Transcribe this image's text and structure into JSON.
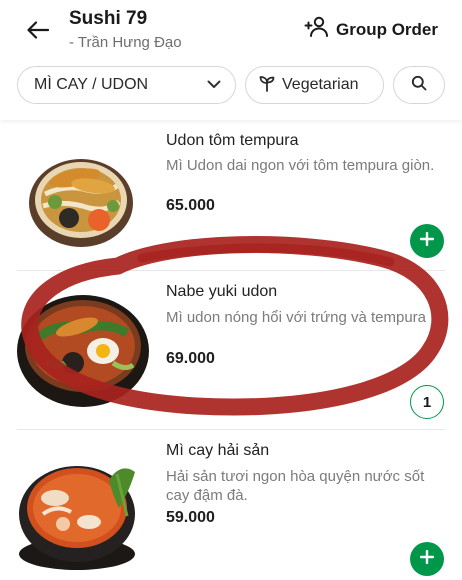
{
  "header": {
    "store_name": "Sushi 79",
    "store_branch": "- Trần Hưng Đạo",
    "group_order_label": "Group Order"
  },
  "filters": {
    "category": "MÌ CAY / UDON",
    "vegetarian": "Vegetarian"
  },
  "items": [
    {
      "name": "Udon tôm tempura",
      "description": "Mì Udon dai ngon với tôm tempura giòn.",
      "price": "65.000"
    },
    {
      "name": "Nabe yuki udon",
      "description": "Mì udon nóng hổi với trứng và tempura",
      "price": "69.000",
      "quantity": "1"
    },
    {
      "name": "Mì cay hải sản",
      "description": "Hải sản tươi ngon hòa quyện nước sốt cay đậm đà.",
      "price": "59.000"
    }
  ],
  "colors": {
    "accent_green": "#00974a",
    "annotation_red": "#a8231e"
  }
}
